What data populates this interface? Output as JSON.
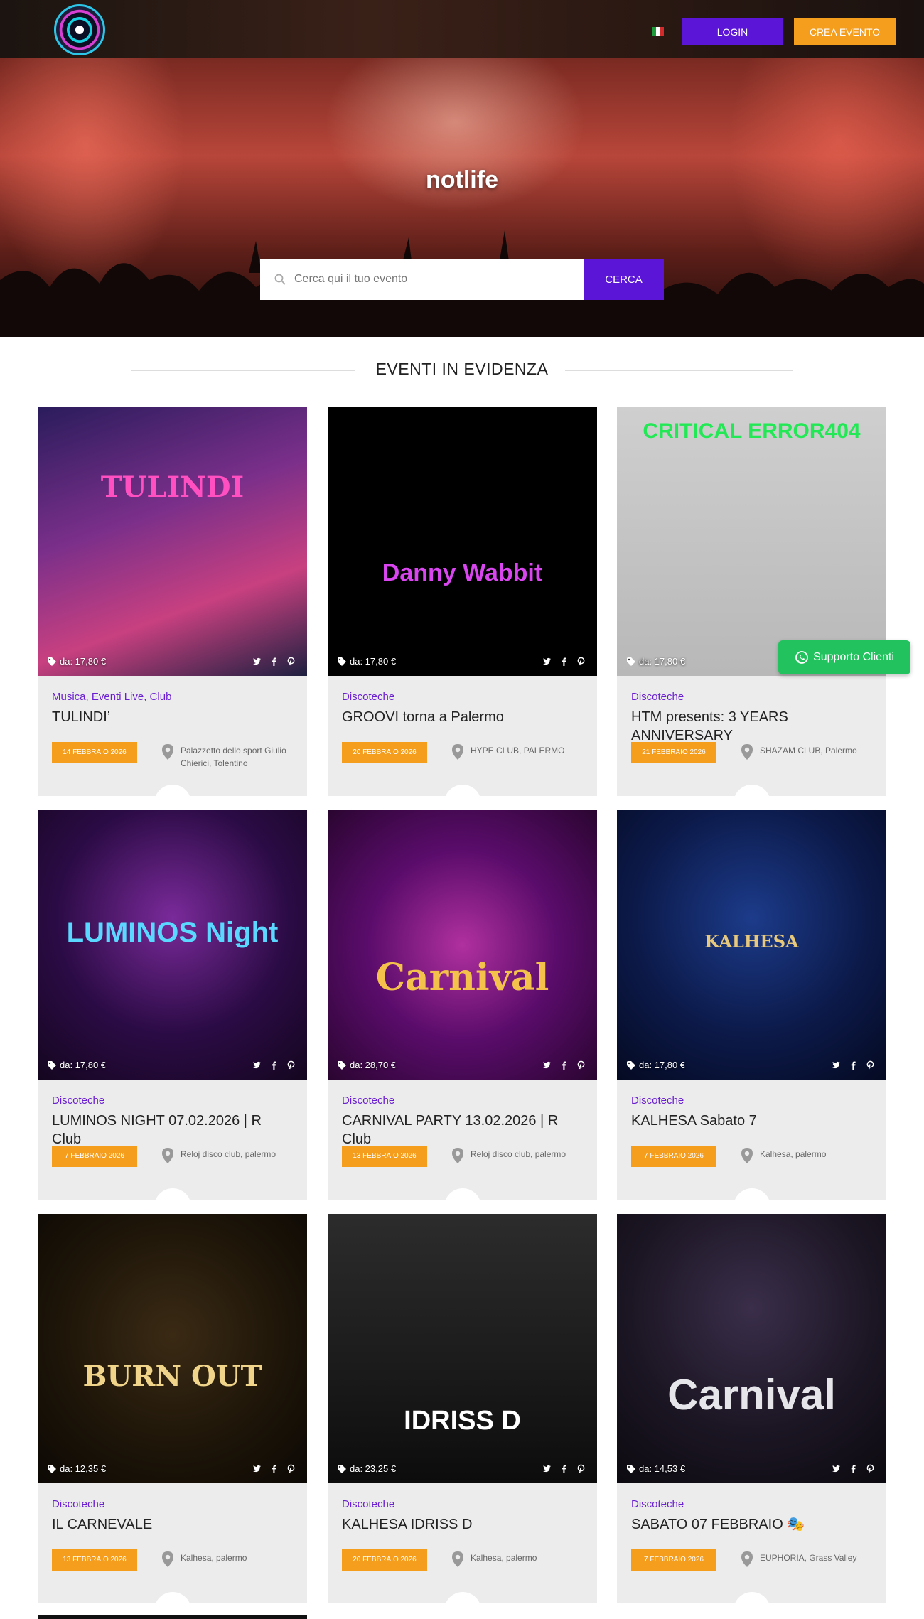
{
  "header": {
    "language_flag": "it-flag-icon",
    "login_label": "LOGIN",
    "crea_label": "CREA EVENTO",
    "colors": {
      "login": "#5b15d6",
      "crea": "#f59d1d"
    }
  },
  "hero": {
    "title": "notlife",
    "search_placeholder": "Cerca qui il tuo evento",
    "search_button": "CERCA"
  },
  "section": {
    "title": "EVENTI IN EVIDENZA"
  },
  "events": [
    {
      "price": "da: 17,80 €",
      "category": "Musica, Eventi Live, Club",
      "title": "TULINDI’",
      "date": "14 FEBBRAIO 2026",
      "location": "Palazzetto dello sport Giulio Chierici, Tolentino",
      "poster_text": "TULINDI"
    },
    {
      "price": "da: 17,80 €",
      "category": "Discoteche",
      "title": "GROOVI torna a Palermo",
      "date": "20 FEBBRAIO 2026",
      "location": "HYPE CLUB, PALERMO",
      "poster_text": "Danny Wabbit"
    },
    {
      "price": "da: 17,80 €",
      "category": "Discoteche",
      "title": "HTM presents: 3 YEARS ANNIVERSARY",
      "date": "21 FEBBRAIO 2026",
      "location": "SHAZAM CLUB, Palermo",
      "poster_text": "CRITICAL ERROR404"
    },
    {
      "price": "da: 17,80 €",
      "category": "Discoteche",
      "title": "LUMINOS NIGHT 07.02.2026 | R Club",
      "date": "7 FEBBRAIO 2026",
      "location": "Reloj disco club, palermo",
      "poster_text": "LUMINOS Night"
    },
    {
      "price": "da: 28,70 €",
      "category": "Discoteche",
      "title": "CARNIVAL PARTY 13.02.2026 | R Club",
      "date": "13 FEBBRAIO 2026",
      "location": "Reloj disco club, palermo",
      "poster_text": "Carnival"
    },
    {
      "price": "da: 17,80 €",
      "category": "Discoteche",
      "title": "KALHESA Sabato 7",
      "date": "7 FEBBRAIO 2026",
      "location": "Kalhesa, palermo",
      "poster_text": "KALHESA"
    },
    {
      "price": "da: 12,35 €",
      "category": "Discoteche",
      "title": "IL CARNEVALE",
      "date": "13 FEBBRAIO 2026",
      "location": "Kalhesa, palermo",
      "poster_text": "BURN OUT"
    },
    {
      "price": "da: 23,25 €",
      "category": "Discoteche",
      "title": "KALHESA IDRISS D",
      "date": "20 FEBBRAIO 2026",
      "location": "Kalhesa, palermo",
      "poster_text": "IDRISS D"
    },
    {
      "price": "da: 14,53 €",
      "category": "Discoteche",
      "title": "SABATO 07 FEBBRAIO 🎭",
      "date": "7 FEBBRAIO 2026",
      "location": "EUPHORIA, Grass Valley",
      "poster_text": "Carnival"
    }
  ],
  "support": {
    "label": "Supporto Clienti",
    "color": "#22c35e"
  }
}
